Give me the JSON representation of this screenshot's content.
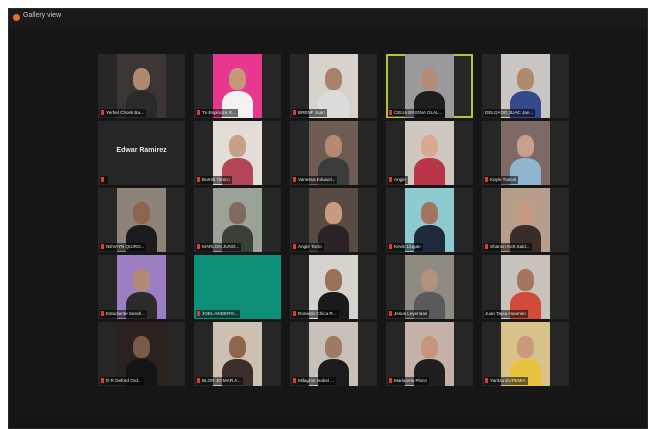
{
  "window": {
    "title": "Gallery view",
    "app_icon": "zoom-app-icon"
  },
  "participants": [
    {
      "name": "Yerbel Chosk Ba...",
      "muted": true,
      "video": true,
      "bg": "#3b3633",
      "skin": "#b08a70",
      "shirt": "#2a2a2a"
    },
    {
      "name": "Tu Espinoza R...",
      "muted": true,
      "video": true,
      "bg": "#e8378f",
      "skin": "#c6987a",
      "shirt": "#f2f2f2"
    },
    {
      "name": "BRENF Juan",
      "muted": true,
      "video": true,
      "bg": "#d7d2cc",
      "skin": "#a8826a",
      "shirt": "#dcdcdc"
    },
    {
      "name": "CELIA BRIGNA OLAL...",
      "muted": true,
      "video": true,
      "active": true,
      "bg": "#9a9a9c",
      "skin": "#b48d76",
      "shirt": "#1e1e1e"
    },
    {
      "name": "DELGADO JUAC Jan...",
      "muted": false,
      "video": true,
      "bg": "#c9c6c4",
      "skin": "#b08a6c",
      "shirt": "#344a8c"
    },
    {
      "name": "Edwar Ramirez",
      "muted": true,
      "video": false,
      "bg": "#262626"
    },
    {
      "name": "Burridi Tanico",
      "muted": true,
      "video": true,
      "bg": "#e2ddd6",
      "skin": "#c7a08a",
      "shirt": "#b2455a"
    },
    {
      "name": "Vanessa Eduard...",
      "muted": true,
      "video": true,
      "bg": "#6e5c52",
      "skin": "#b48a70",
      "shirt": "#3b3b3b"
    },
    {
      "name": "Angie",
      "muted": true,
      "video": true,
      "bg": "#cfc8c0",
      "skin": "#d8a892",
      "shirt": "#b8354a"
    },
    {
      "name": "Kayle Tuscai",
      "muted": true,
      "video": true,
      "bg": "#7d6a64",
      "skin": "#c8a08e",
      "shirt": "#8fb5cf"
    },
    {
      "name": "NEVAYN QUIRO...",
      "muted": true,
      "video": true,
      "bg": "#8d8378",
      "skin": "#8c6450",
      "shirt": "#1c1c1c"
    },
    {
      "name": "MARLON JUNO...",
      "muted": true,
      "video": true,
      "bg": "#9ba297",
      "skin": "#7f6b5e",
      "shirt": "#3a3f3a"
    },
    {
      "name": "Angie Taclo",
      "muted": true,
      "video": true,
      "bg": "#5a4a44",
      "skin": "#c79a82",
      "shirt": "#2a2226"
    },
    {
      "name": "Kevin Llugan",
      "muted": true,
      "video": true,
      "bg": "#8dcbd1",
      "skin": "#a2765e",
      "shirt": "#1f2a3a"
    },
    {
      "name": "Shanon Kett Sald...",
      "muted": true,
      "video": true,
      "bg": "#b69e8a",
      "skin": "#c69a80",
      "shirt": "#3a2c2a"
    },
    {
      "name": "Estudiante Sarah...",
      "muted": true,
      "video": true,
      "bg": "#9b7fc2",
      "skin": "#b58a72",
      "shirt": "#2b2b2b"
    },
    {
      "name": "JOEL ANDERO...",
      "muted": true,
      "video": true,
      "bg": "#0d8f78",
      "skin": "#0d8f78",
      "shirt": "#0d8f78",
      "plain": true
    },
    {
      "name": "Ronaldo Chica R...",
      "muted": true,
      "video": true,
      "bg": "#d6d3ce",
      "skin": "#9b7058",
      "shirt": "#1a1a1a"
    },
    {
      "name": "Jesus Leyendas",
      "muted": true,
      "video": true,
      "bg": "#8f8a82",
      "skin": "#b2917e",
      "shirt": "#5a5a5a"
    },
    {
      "name": "Juan Tapia Huamán",
      "muted": false,
      "video": true,
      "bg": "#c8c3bd",
      "skin": "#a5765e",
      "shirt": "#d24a3a"
    },
    {
      "name": "D R Deford Ord...",
      "muted": true,
      "video": true,
      "bg": "#2b211e",
      "skin": "#7a5a48",
      "shirt": "#141414"
    },
    {
      "name": "BLOR JO MAR A...",
      "muted": true,
      "video": true,
      "bg": "#cdbfb2",
      "skin": "#8f654c",
      "shirt": "#3c2e2a"
    },
    {
      "name": "Milagros Isabel ...",
      "muted": true,
      "video": true,
      "bg": "#c7c1b9",
      "skin": "#a07a62",
      "shirt": "#1c1c1c"
    },
    {
      "name": "Marianela Pinco",
      "muted": true,
      "video": true,
      "bg": "#c4b2a8",
      "skin": "#c8957a",
      "shirt": "#1f1f1f"
    },
    {
      "name": "Yaritza EUFEMIA",
      "muted": true,
      "video": true,
      "bg": "#d9c28a",
      "skin": "#c99a7c",
      "shirt": "#e7c23a"
    }
  ]
}
